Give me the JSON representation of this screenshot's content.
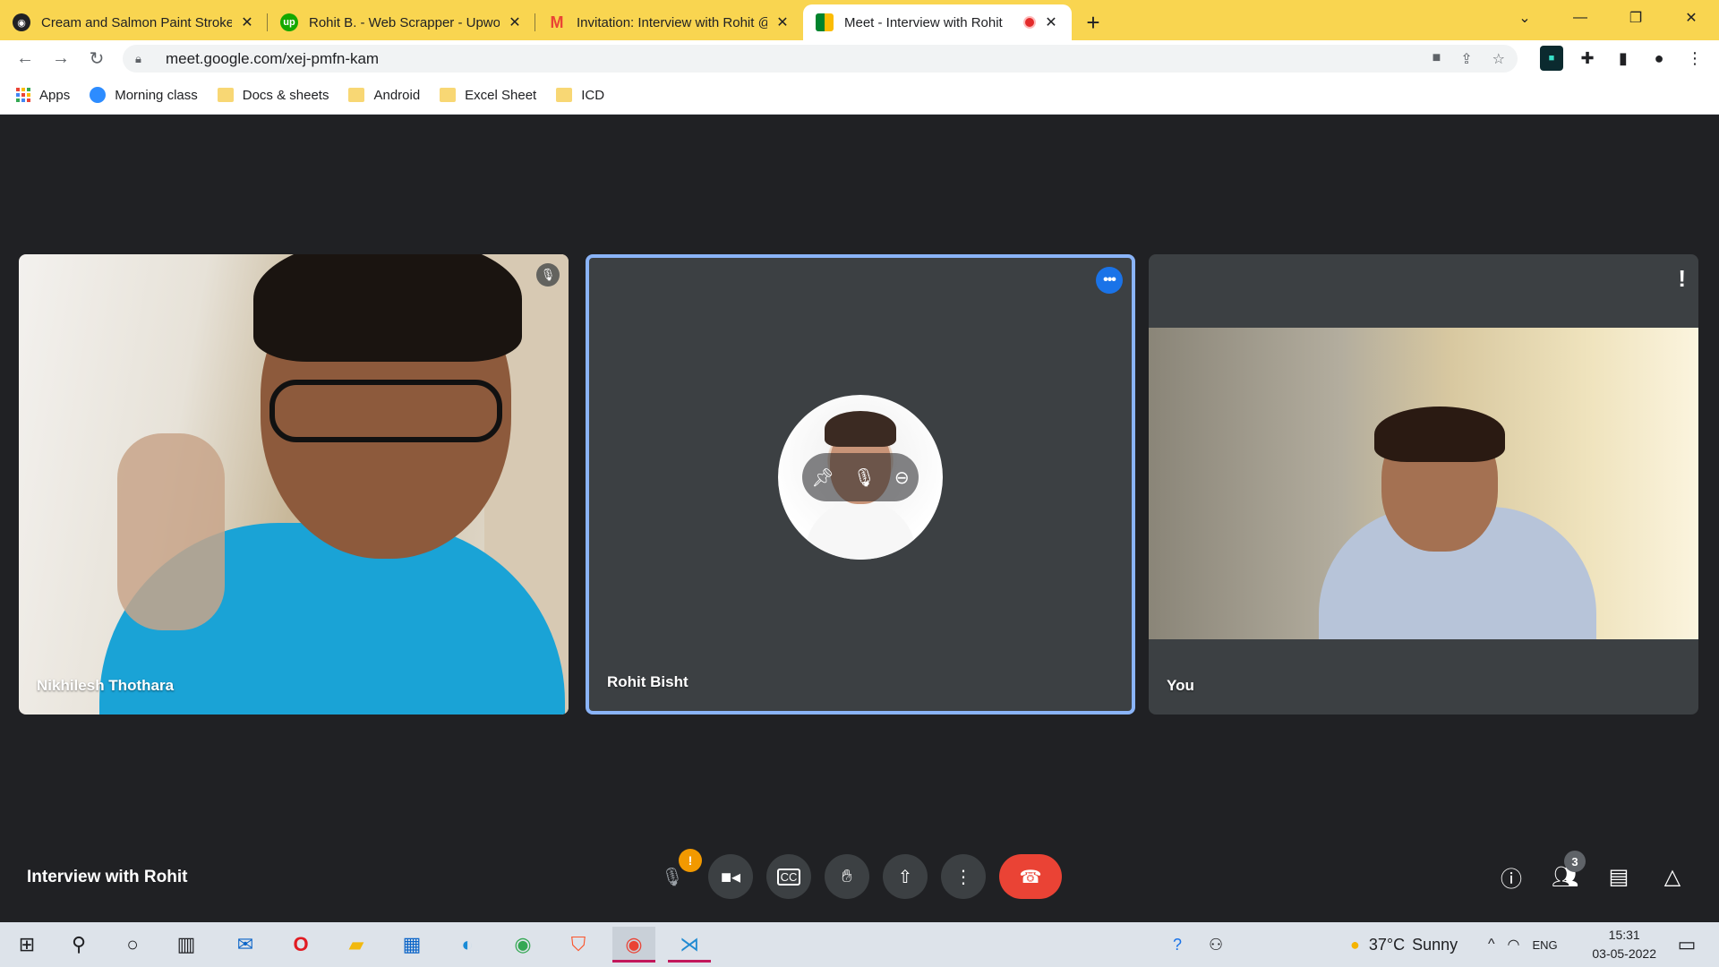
{
  "browser": {
    "tabs": [
      {
        "title": "Cream and Salmon Paint Strokes",
        "favicon": "camera-shutter-icon",
        "color": "#202124"
      },
      {
        "title": "Rohit B. - Web Scrapper - Upwork",
        "favicon": "upwork-icon",
        "color": "#14a800"
      },
      {
        "title": "Invitation: Interview with Rohit @",
        "favicon": "gmail-icon",
        "color": "#ea4335"
      },
      {
        "title": "Meet - Interview with Rohit",
        "favicon": "meet-icon",
        "color": "#00832d"
      }
    ],
    "new_tab": "+",
    "url": "meet.google.com/xej-pmfn-kam",
    "bookmarks": [
      {
        "label": "Apps",
        "icon": "apps-grid-icon"
      },
      {
        "label": "Morning class",
        "icon": "zoom-icon"
      },
      {
        "label": "Docs & sheets",
        "icon": "folder-icon"
      },
      {
        "label": "Android",
        "icon": "folder-icon"
      },
      {
        "label": "Excel Sheet",
        "icon": "folder-icon"
      },
      {
        "label": "ICD",
        "icon": "folder-icon"
      }
    ]
  },
  "meet": {
    "meeting_title": "Interview with Rohit",
    "participants": [
      {
        "name": "Nikhilesh Thothara"
      },
      {
        "name": "Rohit Bisht"
      },
      {
        "name": "You"
      }
    ],
    "mic_alert": "!",
    "people_count": "3",
    "accent": "#8ab4f8",
    "leave_color": "#ea4335"
  },
  "taskbar": {
    "weather_temp": "37°C",
    "weather_desc": "Sunny",
    "language": "ENG",
    "time": "15:31",
    "date": "03-05-2022"
  }
}
